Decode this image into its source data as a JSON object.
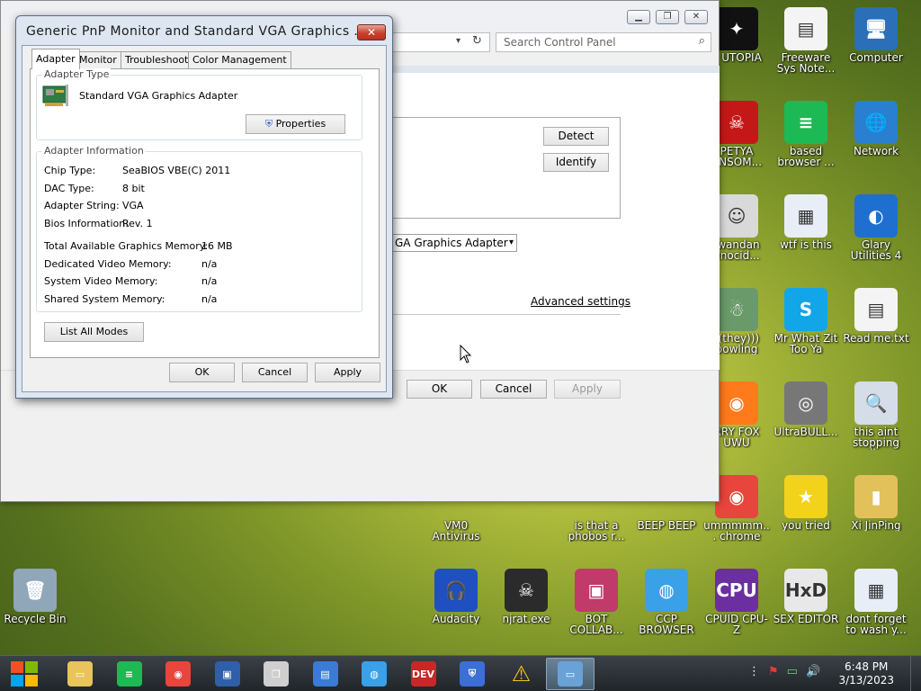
{
  "desktop": {
    "icons": [
      {
        "id": "utopia",
        "label": "P UTOPIA",
        "glyph": "✦",
        "color": "#111111"
      },
      {
        "id": "freeware",
        "label": "Freeware Sys Note...",
        "glyph": "▤",
        "color": "#f4f4f4"
      },
      {
        "id": "computer",
        "label": "Computer",
        "glyph": "🖥",
        "color": "#2a6fb8"
      },
      {
        "id": "petya",
        "label": "PETYA ANSOM...",
        "glyph": "☠",
        "color": "#c41818"
      },
      {
        "id": "based",
        "label": "based browser ...",
        "glyph": "≡",
        "color": "#1db954"
      },
      {
        "id": "network",
        "label": "Network",
        "glyph": "🌐",
        "color": "#2a7fd0"
      },
      {
        "id": "rwandan",
        "label": ".wandan enocid...",
        "glyph": "☺",
        "color": "#d9d9d9"
      },
      {
        "id": "wtf",
        "label": "wtf is this",
        "glyph": "▦",
        "color": "#e8eef8"
      },
      {
        "id": "glary",
        "label": "Glary Utilities 4",
        "glyph": "◐",
        "color": "#1f6fd0"
      },
      {
        "id": "they",
        "label": "((they))) bowling",
        "glyph": "☃",
        "color": "#6a9a6a"
      },
      {
        "id": "skype",
        "label": "Mr What Zit Too Ya",
        "glyph": "S",
        "color": "#12a5e8"
      },
      {
        "id": "readme",
        "label": "Read me.txt",
        "glyph": "▤",
        "color": "#f4f4f4"
      },
      {
        "id": "furryfox",
        "label": "RRY FOX UWU",
        "glyph": "◉",
        "color": "#ff7a1a"
      },
      {
        "id": "ultrabull",
        "label": "UltraBULL...",
        "glyph": "◎",
        "color": "#777777"
      },
      {
        "id": "thisaint",
        "label": "this aint stopping di...",
        "glyph": "🔍",
        "color": "#d4dde8"
      },
      {
        "id": "vmo",
        "label": "VM0 Antivirus",
        "glyph": "",
        "color": "#556b2f"
      },
      {
        "id": "phobos",
        "label": "is that a phobos r...",
        "glyph": "",
        "color": "#556b2f"
      },
      {
        "id": "beep",
        "label": "BEEP BEEP",
        "glyph": "",
        "color": "#556b2f"
      },
      {
        "id": "chrome",
        "label": "ummmmm... chrome",
        "glyph": "◉",
        "color": "#e8453c"
      },
      {
        "id": "youtried",
        "label": "you tried",
        "glyph": "★",
        "color": "#f2d21b"
      },
      {
        "id": "xijinping",
        "label": "Xi JinPing",
        "glyph": "▮",
        "color": "#e3c15a"
      },
      {
        "id": "recycle",
        "label": "Recycle Bin",
        "glyph": "🗑",
        "color": "#8fa7b8"
      },
      {
        "id": "audacity",
        "label": "Audacity",
        "glyph": "🎧",
        "color": "#1f4fc0"
      },
      {
        "id": "njrat",
        "label": "njrat.exe",
        "glyph": "☠",
        "color": "#2b2b2b"
      },
      {
        "id": "botcollab",
        "label": "BOT COLLAB...",
        "glyph": "▣",
        "color": "#c03a6a"
      },
      {
        "id": "ccpbrowser",
        "label": "CCP BROWSER",
        "glyph": "◍",
        "color": "#3aa0e8"
      },
      {
        "id": "cpuz",
        "label": "CPUID CPU-Z",
        "glyph": "CPU",
        "color": "#6b2fa0"
      },
      {
        "id": "sexeditor",
        "label": "SEX EDITOR",
        "glyph": "HxD",
        "color": "#e8e8e8"
      },
      {
        "id": "dontforget",
        "label": "dont forget to wash y...",
        "glyph": "▦",
        "color": "#e8eef8"
      }
    ]
  },
  "control_panel": {
    "search_placeholder": "Search Control Panel",
    "detect": "Detect",
    "identify": "Identify",
    "display_select": "GA Graphics Adapter",
    "advanced": "Advanced settings",
    "ok": "OK",
    "cancel": "Cancel",
    "apply": "Apply"
  },
  "dialog": {
    "title": "Generic PnP Monitor and Standard VGA Graphics ...",
    "close_glyph": "✕",
    "tabs": [
      "Adapter",
      "Monitor",
      "Troubleshoot",
      "Color Management"
    ],
    "adapter_type_title": "Adapter Type",
    "adapter_name": "Standard VGA Graphics Adapter",
    "properties_label": "Properties",
    "adapter_info_title": "Adapter Information",
    "info": [
      {
        "k": "Chip Type:",
        "v": "SeaBIOS VBE(C) 2011"
      },
      {
        "k": "DAC Type:",
        "v": "8 bit"
      },
      {
        "k": "Adapter String:",
        "v": "VGA"
      },
      {
        "k": "Bios Information:",
        "v": "Rev. 1"
      }
    ],
    "memory": [
      {
        "k": "Total Available Graphics Memory:",
        "v": "16 MB"
      },
      {
        "k": "Dedicated Video Memory:",
        "v": "n/a"
      },
      {
        "k": "System Video Memory:",
        "v": "n/a"
      },
      {
        "k": "Shared System Memory:",
        "v": "n/a"
      }
    ],
    "list_all_modes": "List All Modes",
    "ok": "OK",
    "cancel": "Cancel",
    "apply": "Apply"
  },
  "taskbar": {
    "apps": [
      {
        "id": "explorer",
        "glyph": "▭",
        "color": "#e9c45a"
      },
      {
        "id": "notes",
        "glyph": "≡",
        "color": "#1db954"
      },
      {
        "id": "chrome",
        "glyph": "◉",
        "color": "#e8453c"
      },
      {
        "id": "virtualbox",
        "glyph": "▣",
        "color": "#2f5fa8"
      },
      {
        "id": "windows",
        "glyph": "❐",
        "color": "#cfcfcf"
      },
      {
        "id": "vbox2",
        "glyph": "▤",
        "color": "#3a7bd5"
      },
      {
        "id": "ccp",
        "glyph": "◍",
        "color": "#3aa0e8"
      },
      {
        "id": "devcpp",
        "glyph": "DEV",
        "color": "#c62828"
      },
      {
        "id": "shield",
        "glyph": "⛨",
        "color": "#3b6fd6"
      },
      {
        "id": "warning",
        "glyph": "⚠",
        "color": "#f2c21b"
      },
      {
        "id": "display",
        "glyph": "▭",
        "color": "#6aa2d8"
      }
    ],
    "time": "6:48 PM",
    "date": "3/13/2023",
    "tray": [
      "⋮",
      "⚑",
      "▭",
      "🔊"
    ]
  }
}
